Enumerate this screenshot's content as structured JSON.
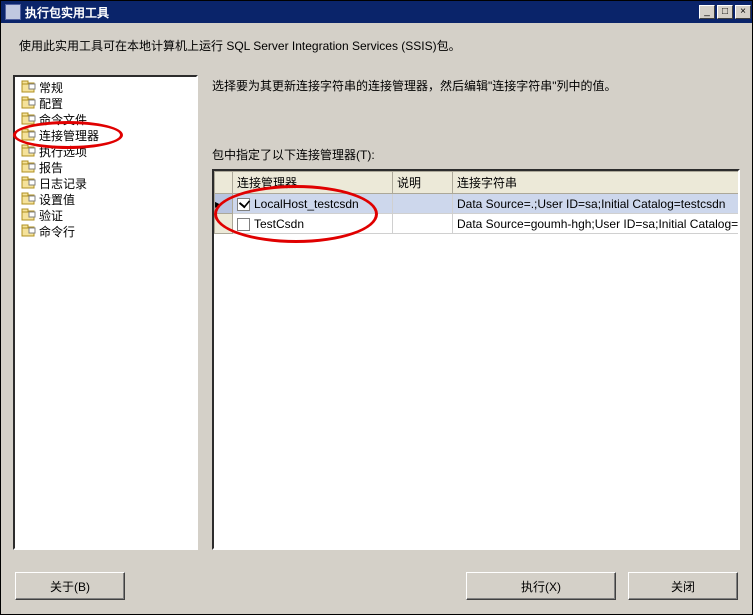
{
  "window": {
    "title": "执行包实用工具"
  },
  "description": "使用此实用工具可在本地计算机上运行 SQL Server Integration Services (SSIS)包。",
  "tree": {
    "items": [
      {
        "label": "常规"
      },
      {
        "label": "配置"
      },
      {
        "label": "命令文件"
      },
      {
        "label": "连接管理器",
        "selected": true
      },
      {
        "label": "执行选项"
      },
      {
        "label": "报告"
      },
      {
        "label": "日志记录"
      },
      {
        "label": "设置值"
      },
      {
        "label": "验证"
      },
      {
        "label": "命令行"
      }
    ]
  },
  "panel": {
    "instruction": "选择要为其更新连接字符串的连接管理器，然后编辑\"连接字符串\"列中的值。",
    "list_label": "包中指定了以下连接管理器(T):",
    "columns": {
      "manager": "连接管理器",
      "desc": "说明",
      "connstr": "连接字符串"
    },
    "rows": [
      {
        "checked": true,
        "name": "LocalHost_testcsdn",
        "desc": "",
        "connstr": "Data Source=.;User ID=sa;Initial Catalog=testcsdn",
        "selected": true
      },
      {
        "checked": false,
        "name": "TestCsdn",
        "desc": "",
        "connstr": "Data Source=goumh-hgh;User ID=sa;Initial Catalog=",
        "selected": false
      }
    ]
  },
  "buttons": {
    "about": "关于(B)",
    "execute": "执行(X)",
    "close": "关闭"
  },
  "icons": {
    "minimize": "_",
    "maximize": "□",
    "close": "×"
  }
}
